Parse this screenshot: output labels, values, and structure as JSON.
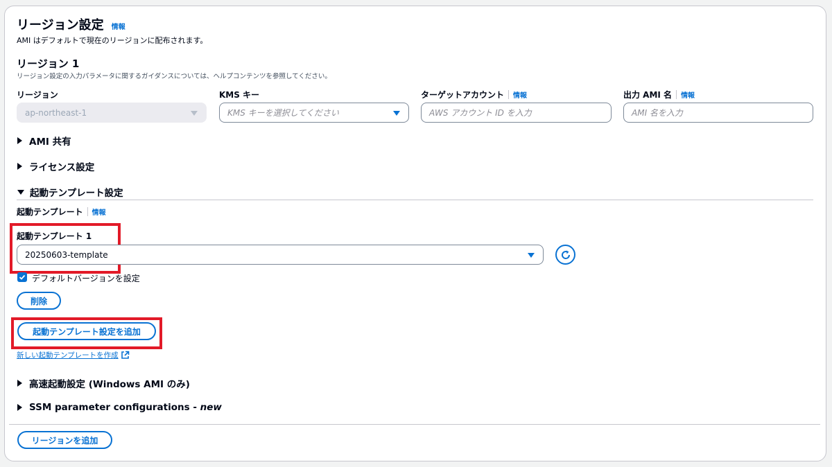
{
  "section": {
    "title": "リージョン設定",
    "info": "情報",
    "description": "AMI はデフォルトで現在のリージョンに配布されます。"
  },
  "region1": {
    "title": "リージョン 1",
    "guidance": "リージョン設定の入力パラメータに関するガイダンスについては、ヘルプコンテンツを参照してください。",
    "region_label": "リージョン",
    "region_value": "ap-northeast-1",
    "kms_label": "KMS キー",
    "kms_placeholder": "KMS キーを選択してください",
    "target_account_label": "ターゲットアカウント",
    "target_account_info": "情報",
    "target_account_placeholder": "AWS アカウント ID を入力",
    "output_ami_label": "出力 AMI 名",
    "output_ami_info": "情報",
    "output_ami_placeholder": "AMI 名を入力"
  },
  "sections": {
    "ami_sharing": "AMI 共有",
    "license": "ライセンス設定",
    "launch_template": "起動テンプレート設定",
    "fast_launch": "高速起動設定 (Windows AMI のみ)",
    "ssm_prefix": "SSM parameter configurations - ",
    "ssm_new": "new"
  },
  "launch_template": {
    "label": "起動テンプレート",
    "info": "情報",
    "item_label": "起動テンプレート 1",
    "selected_value": "20250603-template",
    "default_version_label": "デフォルトバージョンを設定",
    "default_version_checked": true,
    "delete_button": "削除",
    "add_button": "起動テンプレート設定を追加",
    "create_link": "新しい起動テンプレートを作成"
  },
  "footer": {
    "add_region_button": "リージョンを追加"
  },
  "colors": {
    "accent": "#0972d3",
    "highlight": "#e21a28"
  },
  "icons": {
    "refresh": "refresh-icon",
    "external_link": "external-link-icon",
    "check": "check-icon"
  }
}
